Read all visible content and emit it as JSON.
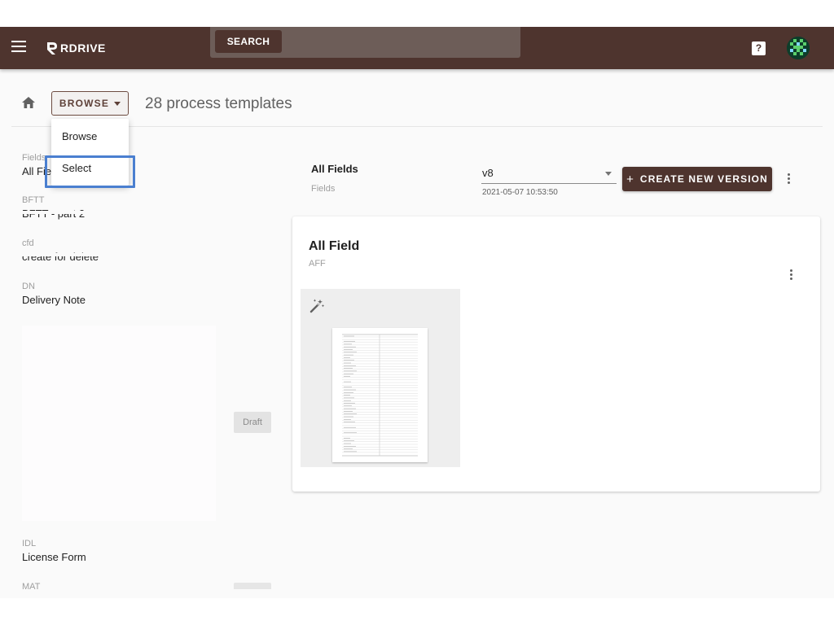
{
  "topbar": {
    "logo_text": "RDRIVE",
    "search_button_label": "SEARCH",
    "help_icon_text": "?"
  },
  "header": {
    "browse_button_label": "BROWSE",
    "count_title": "28 process templates"
  },
  "browse_menu": {
    "items": [
      {
        "label": "Browse"
      },
      {
        "label": "Select"
      }
    ]
  },
  "template_list": {
    "items": [
      {
        "code": "Fields",
        "name": "All Fie"
      },
      {
        "code": "BFTT",
        "name": "BFTT - part 2"
      },
      {
        "code": "cfd",
        "name": "create for delete"
      },
      {
        "code": "DN",
        "name": "Delivery Note"
      },
      {
        "code": "IDL",
        "name": "License Form"
      },
      {
        "code": "MAT",
        "name": ""
      }
    ],
    "status_chip_label": "Draft"
  },
  "detail": {
    "title": "All Fields",
    "subtitle": "Fields",
    "version": {
      "selected": "v8",
      "date": "2021-05-07 10:53:50"
    },
    "create_button_label": "CREATE NEW VERSION",
    "create_button_icon": "+"
  },
  "version_card": {
    "title": "All Field",
    "code": "AFF"
  },
  "colors": {
    "brand": "#4e342e",
    "highlight": "#4a7fd0"
  },
  "icons": {
    "menu": "menu-icon",
    "home": "home-icon",
    "help": "help-icon",
    "more": "more-vert-icon",
    "wand": "auto-fix-wand-icon"
  }
}
